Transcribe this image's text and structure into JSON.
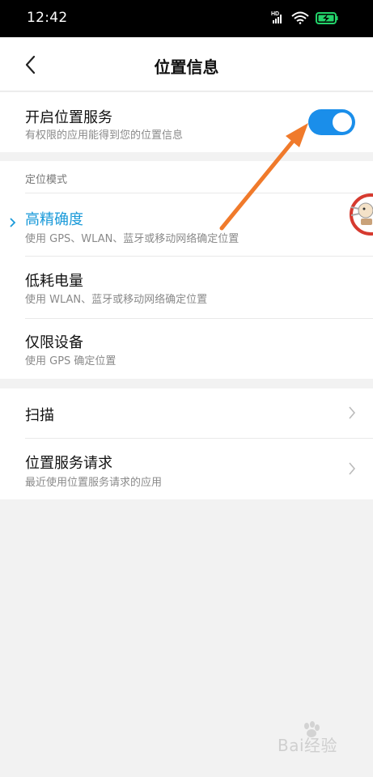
{
  "status_bar": {
    "time": "12:42",
    "icons": [
      "hd-icon",
      "signal-icon",
      "wifi-icon",
      "battery-charging-icon"
    ],
    "battery_color": "#23d36a"
  },
  "header": {
    "title": "位置信息",
    "back_icon": "back-arrow-icon"
  },
  "location_service": {
    "label": "开启位置服务",
    "description": "有权限的应用能得到您的位置信息",
    "enabled": true,
    "toggle_color": "#1a8eea"
  },
  "location_mode": {
    "section_label": "定位模式",
    "options": [
      {
        "label": "高精确度",
        "description": "使用 GPS、WLAN、蓝牙或移动网络确定位置",
        "selected": true
      },
      {
        "label": "低耗电量",
        "description": "使用 WLAN、蓝牙或移动网络确定位置",
        "selected": false
      },
      {
        "label": "仅限设备",
        "description": "使用 GPS 确定位置",
        "selected": false
      }
    ],
    "selected_color": "#1a9ad9"
  },
  "more": {
    "items": [
      {
        "label": "扫描",
        "description": ""
      },
      {
        "label": "位置服务请求",
        "description": "最近使用位置服务请求的应用"
      }
    ]
  },
  "annotation": {
    "arrow_color": "#f07a2b"
  },
  "watermark": {
    "text": "Bai经验"
  }
}
